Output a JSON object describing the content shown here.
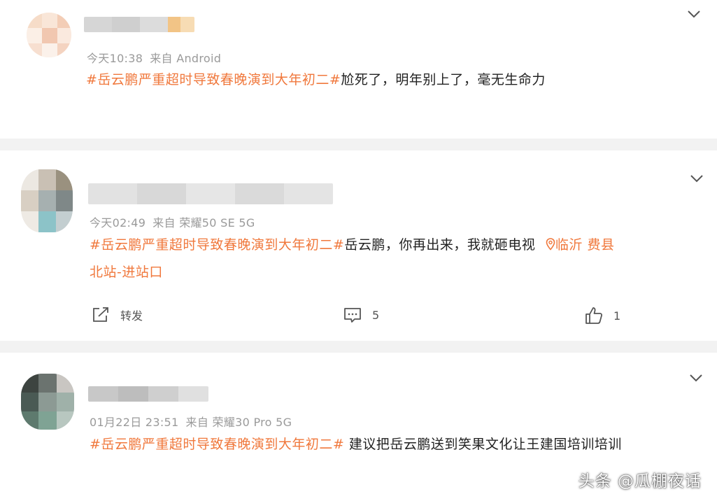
{
  "posts": [
    {
      "meta": {
        "time": "今天10:38",
        "source": "来自 Android"
      },
      "content": {
        "hashtag": "#岳云鹏严重超时导致春晚演到大年初二#",
        "line1_text": "尬死了，明年别上了，毫无生命力"
      }
    },
    {
      "meta": {
        "time": "今天02:49",
        "source": "来自 荣耀50 SE 5G"
      },
      "content": {
        "hashtag": "#岳云鹏严重超时导致春晚演到大年初二#",
        "line1_text": "岳云鹏，你再出来，我就砸电视",
        "location_icon": "location-pin-icon",
        "location_part1": "临沂 费县",
        "location_part2": "北站-进站口"
      },
      "actions": {
        "repost_label": "转发",
        "comment_count": "5",
        "like_count": "1"
      }
    },
    {
      "meta": {
        "time": "01月22日 23:51",
        "source": "来自 荣耀30 Pro 5G"
      },
      "content": {
        "hashtag": "#岳云鹏严重超时导致春晚演到大年初二#",
        "line1_text": " 建议把岳云鹏送到笑果文化让王建国培训培训"
      }
    }
  ],
  "watermark": "头条 @瓜棚夜话",
  "colors": {
    "hashtag": "#f0783c",
    "meta": "#9a9a9a",
    "separator": "#f2f2f2"
  }
}
